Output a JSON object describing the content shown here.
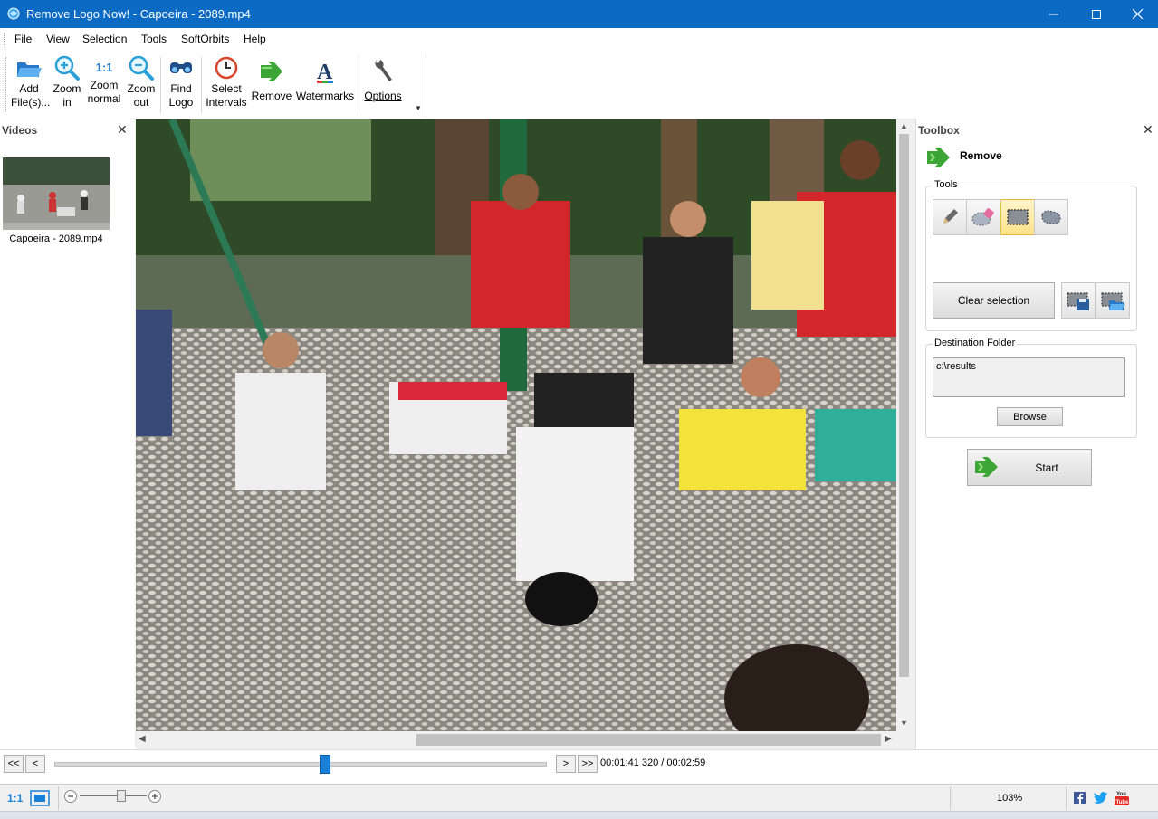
{
  "window": {
    "title": "Remove Logo Now! - Capoeira - 2089.mp4",
    "minimize_icon": "minimize-icon",
    "maximize_icon": "maximize-icon",
    "close_icon": "close-icon"
  },
  "menu": [
    "File",
    "View",
    "Selection",
    "Tools",
    "SoftOrbits",
    "Help"
  ],
  "toolbar": {
    "add_files": [
      "Add",
      "File(s)..."
    ],
    "zoom_in": [
      "Zoom",
      "in"
    ],
    "zoom_normal_glyph": "1:1",
    "zoom_normal": [
      "Zoom",
      "normal"
    ],
    "zoom_out": [
      "Zoom",
      "out"
    ],
    "find_logo": [
      "Find",
      "Logo"
    ],
    "select_intervals": [
      "Select",
      "Intervals"
    ],
    "remove": "Remove",
    "watermarks": "Watermarks",
    "options": "Options"
  },
  "videos_panel": {
    "title": "Videos",
    "items": [
      {
        "label": "Capoeira - 2089.mp4"
      }
    ]
  },
  "toolbox": {
    "title": "Toolbox",
    "section_title": "Remove",
    "tools_group": "Tools",
    "tools": [
      "pencil-icon",
      "eraser-icon",
      "rectangle-select-icon",
      "lasso-select-icon"
    ],
    "active_tool": "rectangle-select-icon",
    "clear_selection": "Clear selection",
    "destination_group": "Destination Folder",
    "destination_value": "c:\\results",
    "browse": "Browse",
    "start": "Start"
  },
  "timeline": {
    "first": "<<",
    "prev": "<",
    "next": ">",
    "last": ">>",
    "position_fraction": 0.55,
    "time": "00:01:41 320 / 00:02:59"
  },
  "statusbar": {
    "ratio_label": "1:1",
    "zoom": "103%"
  },
  "colors": {
    "titlebar": "#0a6ac4",
    "accent_green": "#3ba535",
    "accent_blue": "#1a7fd6",
    "active_tool": "#ffe28a"
  }
}
